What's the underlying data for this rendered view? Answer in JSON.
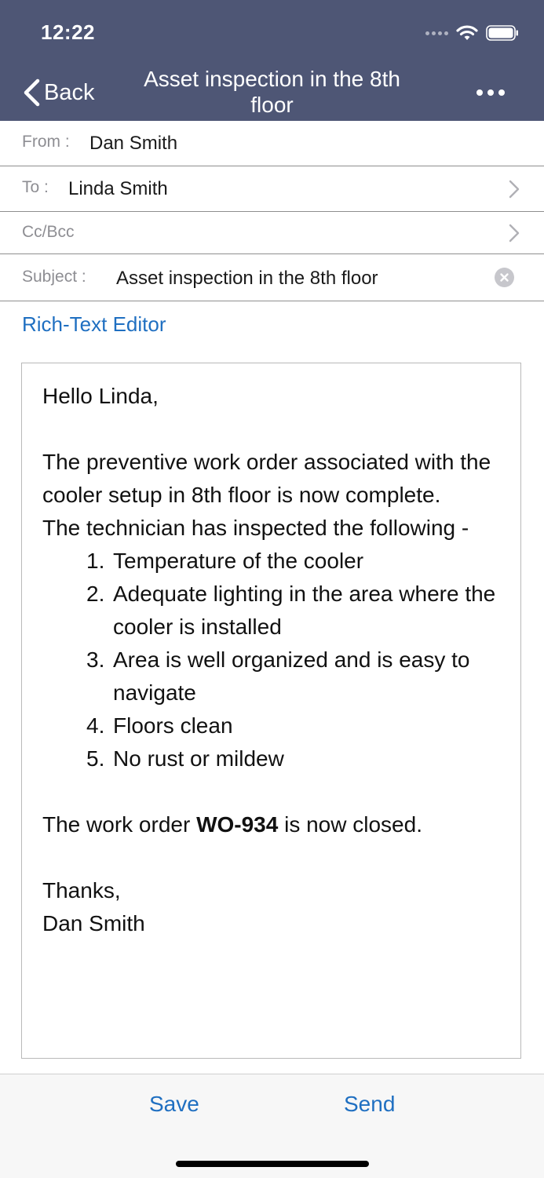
{
  "status_bar": {
    "time": "12:22"
  },
  "nav": {
    "back_label": "Back",
    "title": "Asset inspection in the 8th floor"
  },
  "form": {
    "from": {
      "label": "From :",
      "value": "Dan Smith"
    },
    "to": {
      "label": "To :",
      "value": "Linda Smith"
    },
    "cc_bcc": {
      "label": "Cc/Bcc"
    },
    "subject": {
      "label": "Subject :",
      "value": "Asset inspection in the 8th floor"
    }
  },
  "rich_text_editor_link": "Rich-Text Editor",
  "body": {
    "greeting": "Hello Linda,",
    "paragraph_1": "The preventive work order associated with the cooler setup in 8th floor is now complete.",
    "paragraph_2": "The technician has inspected the following -",
    "list": [
      {
        "num": "1.",
        "text": "Temperature of the cooler"
      },
      {
        "num": "2.",
        "text": "Adequate lighting in the area where the cooler is installed"
      },
      {
        "num": "3.",
        "text": "Area is well organized and is easy to navigate"
      },
      {
        "num": "4.",
        "text": "Floors clean"
      },
      {
        "num": "5.",
        "text": "No rust or mildew"
      }
    ],
    "closing_prefix": "The work order ",
    "work_order_id": "WO-934",
    "closing_suffix": " is now closed.",
    "sign_off": "Thanks,",
    "signature": "Dan Smith"
  },
  "bottom_bar": {
    "save_label": "Save",
    "send_label": "Send"
  },
  "colors": {
    "header_bg": "#4e5675",
    "accent": "#1f6fc1"
  },
  "icons": {
    "back": "chevron-left-icon",
    "more": "ellipsis-icon",
    "row_disclosure": "chevron-right-icon",
    "clear": "clear-circle-icon",
    "wifi": "wifi-icon",
    "battery": "battery-icon",
    "signal": "signal-icon"
  }
}
